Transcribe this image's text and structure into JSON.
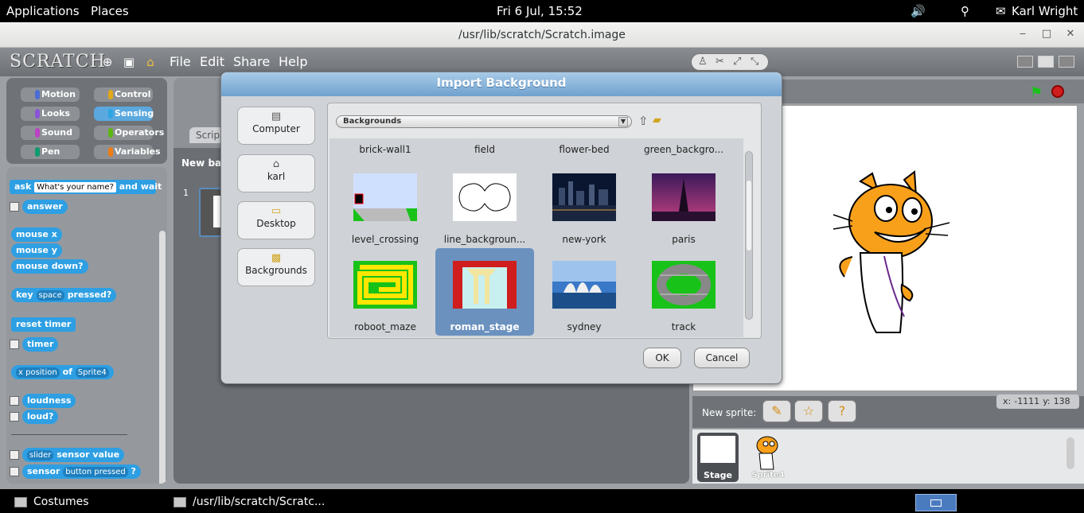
{
  "topbar": {
    "applications": "Applications",
    "places": "Places",
    "clock": "Fri  6 Jul, 15:52",
    "user": "Karl Wright",
    "icons": [
      "volume-icon",
      "network-icon",
      "chat-icon"
    ]
  },
  "window": {
    "title": "/usr/lib/scratch/Scratch.image",
    "controls": [
      "minimize",
      "maximize",
      "close"
    ]
  },
  "scratch": {
    "logo": "SCRATCH",
    "menus": [
      "File",
      "Edit",
      "Share",
      "Help"
    ],
    "categories": [
      {
        "label": "Motion",
        "color": "#4a6cd4"
      },
      {
        "label": "Control",
        "color": "#e1a91a"
      },
      {
        "label": "Looks",
        "color": "#8a55d7"
      },
      {
        "label": "Sensing",
        "color": "#2ca5e2"
      },
      {
        "label": "Sound",
        "color": "#bb42c3"
      },
      {
        "label": "Operators",
        "color": "#5cb712"
      },
      {
        "label": "Pen",
        "color": "#0e9a6c"
      },
      {
        "label": "Variables",
        "color": "#ee7d16"
      }
    ],
    "active_category": "Sensing",
    "blocks": {
      "ask": "ask",
      "ask_input": "What's your name?",
      "and_wait": "and wait",
      "answer": "answer",
      "mouse_x": "mouse x",
      "mouse_y": "mouse y",
      "mouse_down": "mouse down?",
      "key": "key",
      "key_input": "space",
      "pressed": "pressed?",
      "reset_timer": "reset timer",
      "timer": "timer",
      "x_position": "x position",
      "of": "of",
      "sprite4": "Sprite4",
      "loudness": "loudness",
      "loud": "loud?",
      "slider": "slider",
      "sensor_value": "sensor value",
      "sensor": "sensor",
      "button_pressed": "button pressed",
      "question": "?"
    },
    "scripts_tab": "Scrip",
    "new_background": "New back",
    "background_index": "1",
    "mouse_x_label": "x:",
    "mouse_x_value": "-1111",
    "mouse_y_label": "y:",
    "mouse_y_value": "138",
    "new_sprite": "New sprite:",
    "stage_label": "Stage",
    "sprite_label": "Sprite4"
  },
  "dialog": {
    "title": "Import Background",
    "locations": [
      {
        "label": "Computer",
        "icon": "computer-icon"
      },
      {
        "label": "karl",
        "icon": "home-icon"
      },
      {
        "label": "Desktop",
        "icon": "folder-icon"
      },
      {
        "label": "Backgrounds",
        "icon": "backgrounds-icon"
      }
    ],
    "path": "Backgrounds",
    "top_row": [
      "brick-wall1",
      "field",
      "flower-bed",
      "green_backgro..."
    ],
    "files": [
      {
        "name": "level_crossing",
        "selected": false
      },
      {
        "name": "line_backgroun...",
        "selected": false
      },
      {
        "name": "new-york",
        "selected": false
      },
      {
        "name": "paris",
        "selected": false
      },
      {
        "name": "roboot_maze",
        "selected": false
      },
      {
        "name": "roman_stage",
        "selected": true
      },
      {
        "name": "sydney",
        "selected": false
      },
      {
        "name": "track",
        "selected": false
      }
    ],
    "ok": "OK",
    "cancel": "Cancel"
  },
  "taskbar": {
    "items": [
      "Costumes",
      "/usr/lib/scratch/Scratc..."
    ]
  }
}
